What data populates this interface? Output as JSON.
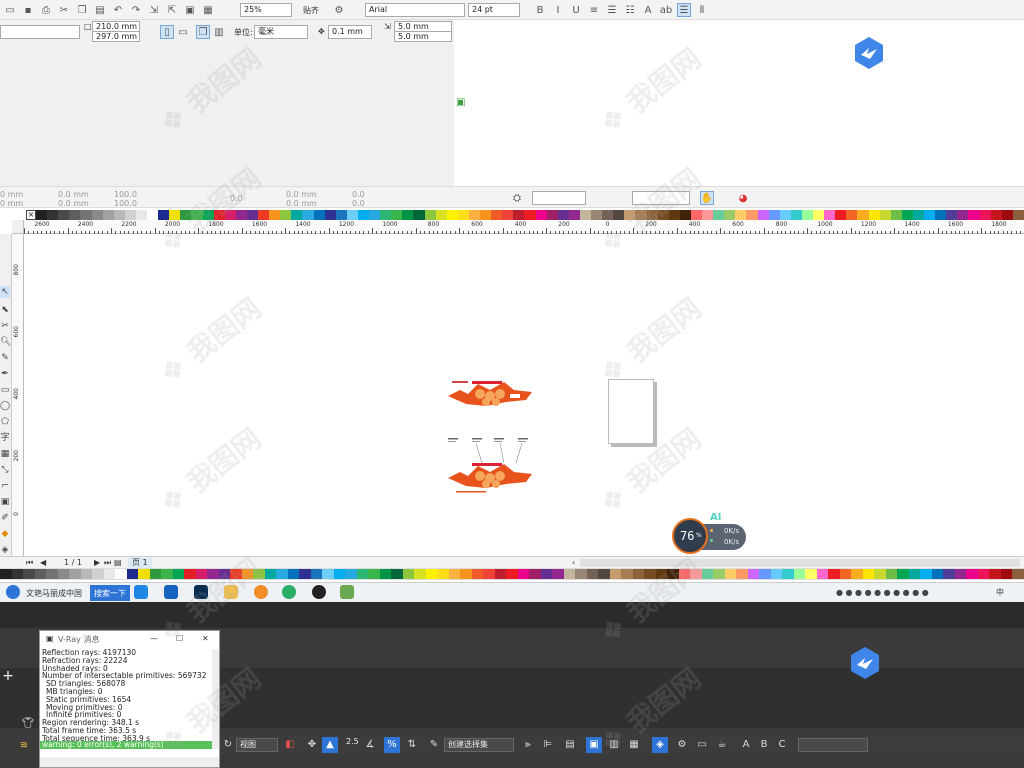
{
  "toolbar1": {
    "zoom": "25%",
    "snap_label": "贴齐",
    "font_name": "Arial",
    "font_size": "24 pt"
  },
  "propbar": {
    "width": "210.0 mm",
    "height": "297.0 mm",
    "units_label": "单位:",
    "units_value": "毫米",
    "nudge": "0.1 mm",
    "dup_x": "5.0 mm",
    "dup_y": "5.0 mm"
  },
  "propbar2": {
    "x": "0 mm",
    "y": "0 mm",
    "w": "0.0 mm",
    "h": "0.0 mm",
    "sx": "100.0",
    "sy": "100.0",
    "rot": "0.0",
    "px": "0.0 mm",
    "py": "0.0 mm",
    "a": "0.0",
    "b": "0.0"
  },
  "ruler_labels": [
    "2600",
    "2400",
    "2200",
    "2000",
    "1800",
    "1600",
    "1400",
    "1200",
    "1000",
    "800",
    "600",
    "400",
    "200",
    "0",
    "200",
    "400",
    "600",
    "800",
    "1000",
    "1200",
    "1400",
    "1600",
    "1800"
  ],
  "vruler_labels": [
    "800",
    "600",
    "400",
    "200",
    "0"
  ],
  "palette_colors": [
    "#202020",
    "#333333",
    "#4a4a4a",
    "#5e5e5e",
    "#737373",
    "#8a8a8a",
    "#a1a1a1",
    "#b8b8b8",
    "#d0d0d0",
    "#e8e8e8",
    "#ffffff",
    "#1d2b8f",
    "#f0e000",
    "#2c9a3d",
    "#3cb44b",
    "#00a651",
    "#e41e26",
    "#d61f69",
    "#92278f",
    "#662d91",
    "#ee3a24",
    "#f7941d",
    "#8dc63f",
    "#00a99d",
    "#29abe2",
    "#0072bc",
    "#2e3192",
    "#1b75bc",
    "#6dcff6",
    "#00aeef",
    "#27aae1",
    "#2bb673",
    "#39b54a",
    "#009444",
    "#006838",
    "#8cc63f",
    "#d7e021",
    "#fff200",
    "#ffde17",
    "#fbb040",
    "#f7941d",
    "#f15a29",
    "#ef4136",
    "#be1e2d",
    "#ed1c24",
    "#ec008c",
    "#9e1f63",
    "#662d91",
    "#92278f",
    "#c2b59b",
    "#998675",
    "#736357",
    "#534741",
    "#c69c6d",
    "#a67c52",
    "#8c6239",
    "#754c24",
    "#603913",
    "#42210b",
    "#ff6666",
    "#ff9999",
    "#66cc99",
    "#99cc66",
    "#ffcc66",
    "#ff9966",
    "#cc66ff",
    "#6699ff",
    "#66ccff",
    "#33cccc",
    "#99ff99",
    "#ffff66",
    "#ff66cc",
    "#ee1d24",
    "#f26522",
    "#f7ac1e",
    "#ffe600",
    "#c7d82f",
    "#6cbe45",
    "#00a651",
    "#00a99d",
    "#00aeef",
    "#0072bc",
    "#4f3d98",
    "#92278f",
    "#ec008c",
    "#ed145b",
    "#c4161c",
    "#9e0b0f",
    "#8b5e3c"
  ],
  "status": {
    "page_count": "1 / 1",
    "page_tab": "页 1"
  },
  "widget": {
    "percent": "76",
    "pct_sign": "%",
    "up": "0K/s",
    "down": "0K/s",
    "ai": "AI"
  },
  "taskbar": {
    "search_text": "搜索一下",
    "app_title": "文艳马丽成中国",
    "tray_lang": "中"
  },
  "max": {
    "view_select": "视图",
    "selection_set": "创建选择集",
    "snap_value": "2.5"
  },
  "vray": {
    "title": "V-Ray 消息",
    "lines": [
      "Reflection rays: 4197130",
      "Refraction rays: 22224",
      "Unshaded rays: 0",
      "Number of intersectable primitives: 569732",
      "SD triangles: 568078",
      "MB triangles: 0",
      "Static primitives: 1654",
      "Moving primitives: 0",
      "Infinite primitives: 0",
      "Region rendering: 348.1 s",
      "Total frame time: 363.5 s",
      "Total sequence time: 363.9 s"
    ],
    "warning": "warning: 0 error(s), 2 warning(s)"
  },
  "accent": "#2e74d6"
}
